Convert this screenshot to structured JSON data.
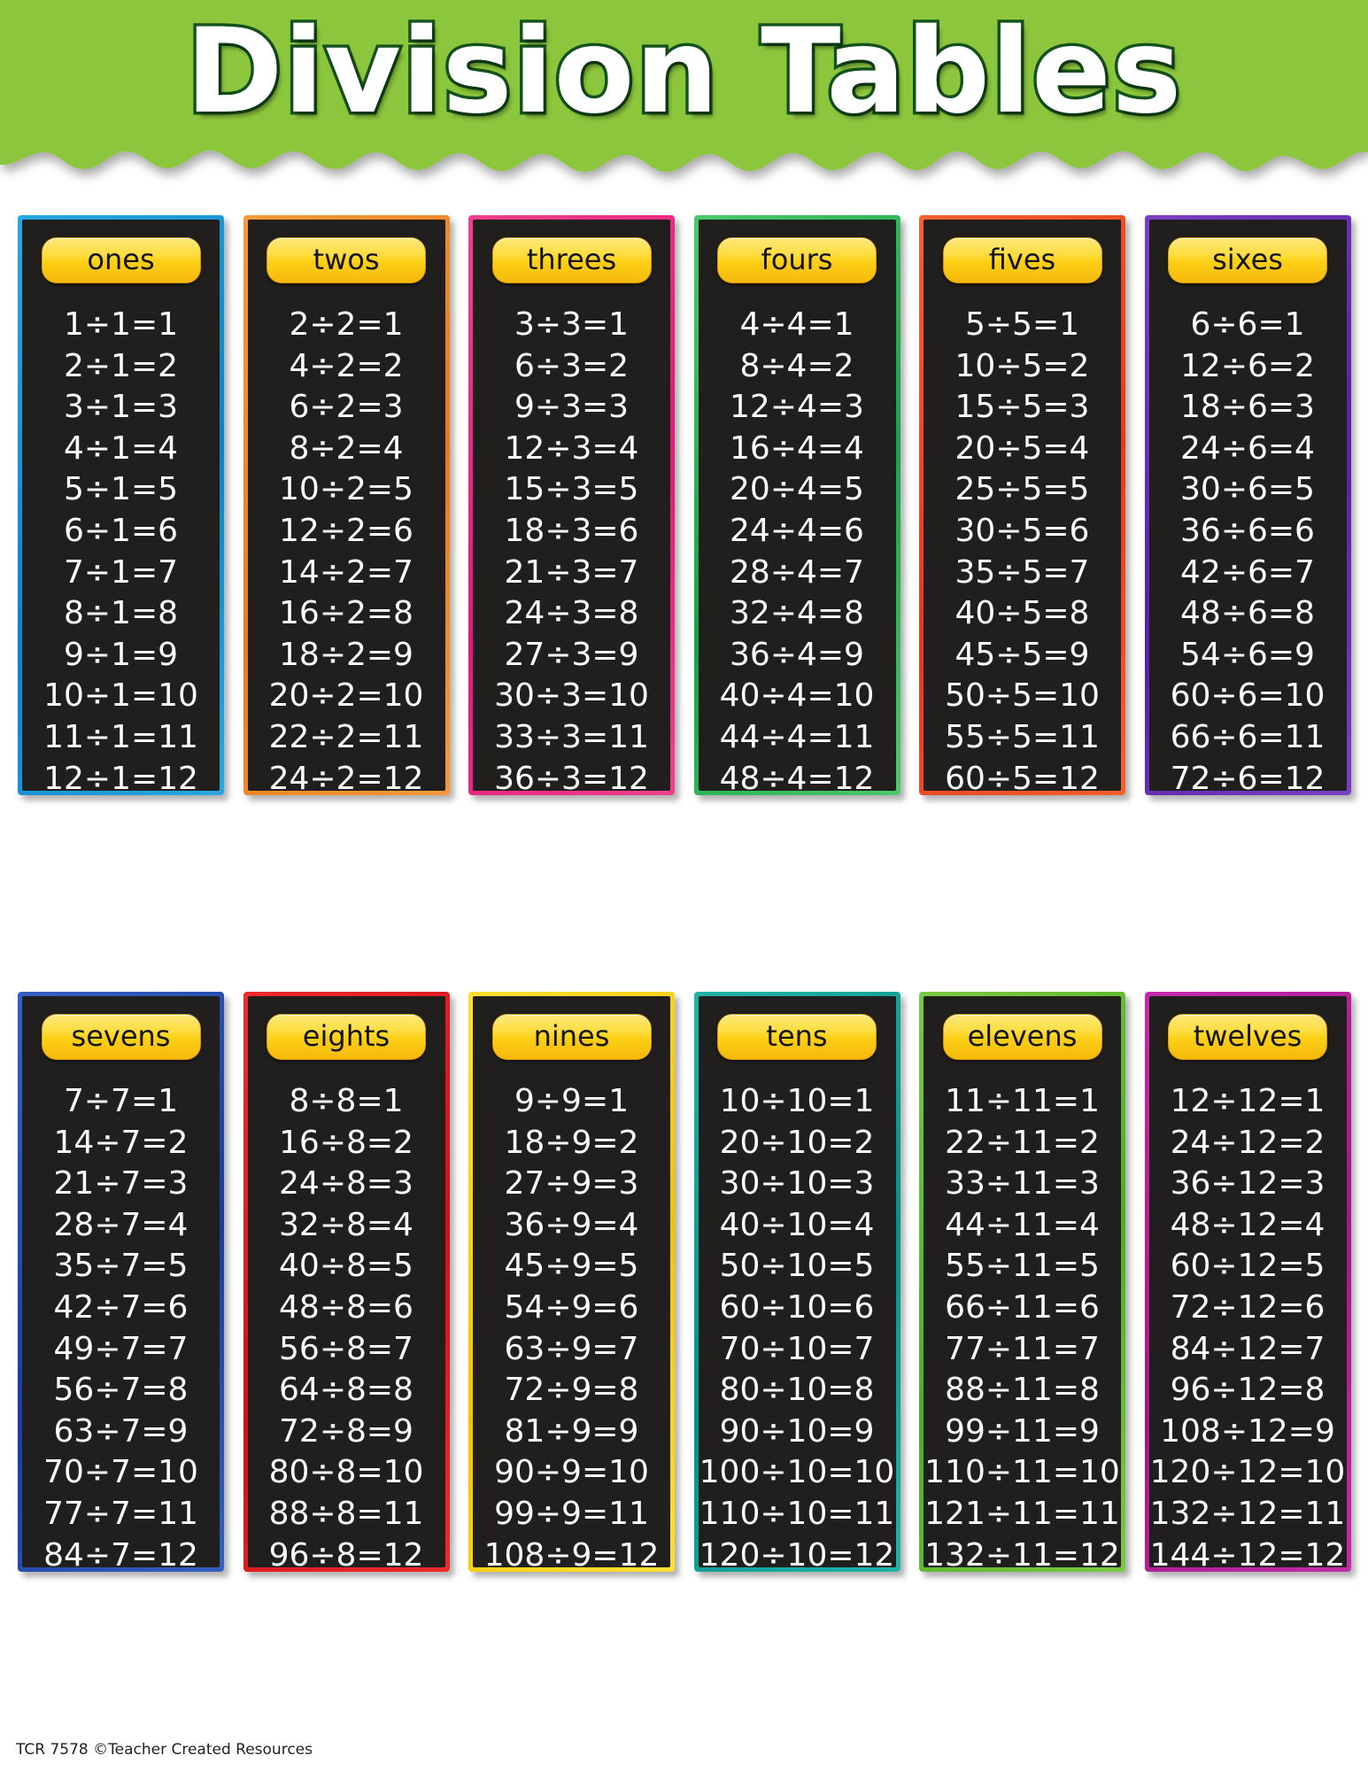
{
  "header": {
    "title": "Division Tables",
    "bg_color": "#8CC63E",
    "title_color": "#FFFFFF",
    "title_outline_color": "#14521B"
  },
  "footer": {
    "text": "TCR 7578  ©Teacher Created Resources"
  },
  "panel_bg_color": "#201F1E",
  "badge_color": "#FCD117",
  "equation_color": "#FDFDFD",
  "tables": [
    {
      "label": "ones",
      "border_outer": "#29A8E0",
      "border_inner": "#0D84C8",
      "divisor": 1,
      "equations": [
        "1÷1=1",
        "2÷1=2",
        "3÷1=3",
        "4÷1=4",
        "5÷1=5",
        "6÷1=6",
        "7÷1=7",
        "8÷1=8",
        "9÷1=9",
        "10÷1=10",
        "11÷1=11",
        "12÷1=12"
      ]
    },
    {
      "label": "twos",
      "border_outer": "#F49A3A",
      "border_inner": "#E97B19",
      "divisor": 2,
      "equations": [
        "2÷2=1",
        "4÷2=2",
        "6÷2=3",
        "8÷2=4",
        "10÷2=5",
        "12÷2=6",
        "14÷2=7",
        "16÷2=8",
        "18÷2=9",
        "20÷2=10",
        "22÷2=11",
        "24÷2=12"
      ]
    },
    {
      "label": "threes",
      "border_outer": "#F0408C",
      "border_inner": "#E2197A",
      "divisor": 3,
      "equations": [
        "3÷3=1",
        "6÷3=2",
        "9÷3=3",
        "12÷3=4",
        "15÷3=5",
        "18÷3=6",
        "21÷3=7",
        "24÷3=8",
        "27÷3=9",
        "30÷3=10",
        "33÷3=11",
        "36÷3=12"
      ]
    },
    {
      "label": "fours",
      "border_outer": "#4CC96B",
      "border_inner": "#15A34A",
      "divisor": 4,
      "equations": [
        "4÷4=1",
        "8÷4=2",
        "12÷4=3",
        "16÷4=4",
        "20÷4=5",
        "24÷4=6",
        "28÷4=7",
        "32÷4=8",
        "36÷4=9",
        "40÷4=10",
        "44÷4=11",
        "48÷4=12"
      ]
    },
    {
      "label": "fives",
      "border_outer": "#F6602E",
      "border_inner": "#E33A1C",
      "divisor": 5,
      "equations": [
        "5÷5=1",
        "10÷5=2",
        "15÷5=3",
        "20÷5=4",
        "25÷5=5",
        "30÷5=6",
        "35÷5=7",
        "40÷5=8",
        "45÷5=9",
        "50÷5=10",
        "55÷5=11",
        "60÷5=12"
      ]
    },
    {
      "label": "sixes",
      "border_outer": "#7B3FC4",
      "border_inner": "#5B1FA8",
      "divisor": 6,
      "equations": [
        "6÷6=1",
        "12÷6=2",
        "18÷6=3",
        "24÷6=4",
        "30÷6=5",
        "36÷6=6",
        "42÷6=7",
        "48÷6=8",
        "54÷6=9",
        "60÷6=10",
        "66÷6=11",
        "72÷6=12"
      ]
    },
    {
      "label": "sevens",
      "border_outer": "#3461C1",
      "border_inner": "#1B3C9E",
      "divisor": 7,
      "equations": [
        "7÷7=1",
        "14÷7=2",
        "21÷7=3",
        "28÷7=4",
        "35÷7=5",
        "42÷7=6",
        "49÷7=7",
        "56÷7=8",
        "63÷7=9",
        "70÷7=10",
        "77÷7=11",
        "84÷7=12"
      ]
    },
    {
      "label": "eights",
      "border_outer": "#EE2B2B",
      "border_inner": "#D2101A",
      "divisor": 8,
      "equations": [
        "8÷8=1",
        "16÷8=2",
        "24÷8=3",
        "32÷8=4",
        "40÷8=5",
        "48÷8=6",
        "56÷8=7",
        "64÷8=8",
        "72÷8=9",
        "80÷8=10",
        "88÷8=11",
        "96÷8=12"
      ]
    },
    {
      "label": "nines",
      "border_outer": "#FFE033",
      "border_inner": "#F5C400",
      "divisor": 9,
      "equations": [
        "9÷9=1",
        "18÷9=2",
        "27÷9=3",
        "36÷9=4",
        "45÷9=5",
        "54÷9=6",
        "63÷9=7",
        "72÷9=8",
        "81÷9=9",
        "90÷9=10",
        "99÷9=11",
        "108÷9=12"
      ]
    },
    {
      "label": "tens",
      "border_outer": "#22B3A6",
      "border_inner": "#069189",
      "divisor": 10,
      "equations": [
        "10÷10=1",
        "20÷10=2",
        "30÷10=3",
        "40÷10=4",
        "50÷10=5",
        "60÷10=6",
        "70÷10=7",
        "80÷10=8",
        "90÷10=9",
        "100÷10=10",
        "110÷10=11",
        "120÷10=12"
      ]
    },
    {
      "label": "elevens",
      "border_outer": "#7AC943",
      "border_inner": "#4CAF20",
      "divisor": 11,
      "equations": [
        "11÷11=1",
        "22÷11=2",
        "33÷11=3",
        "44÷11=4",
        "55÷11=5",
        "66÷11=6",
        "77÷11=7",
        "88÷11=8",
        "99÷11=9",
        "110÷11=10",
        "121÷11=11",
        "132÷11=12"
      ]
    },
    {
      "label": "twelves",
      "border_outer": "#C42BA8",
      "border_inner": "#A4178C",
      "divisor": 12,
      "equations": [
        "12÷12=1",
        "24÷12=2",
        "36÷12=3",
        "48÷12=4",
        "60÷12=5",
        "72÷12=6",
        "84÷12=7",
        "96÷12=8",
        "108÷12=9",
        "120÷12=10",
        "132÷12=11",
        "144÷12=12"
      ]
    }
  ]
}
